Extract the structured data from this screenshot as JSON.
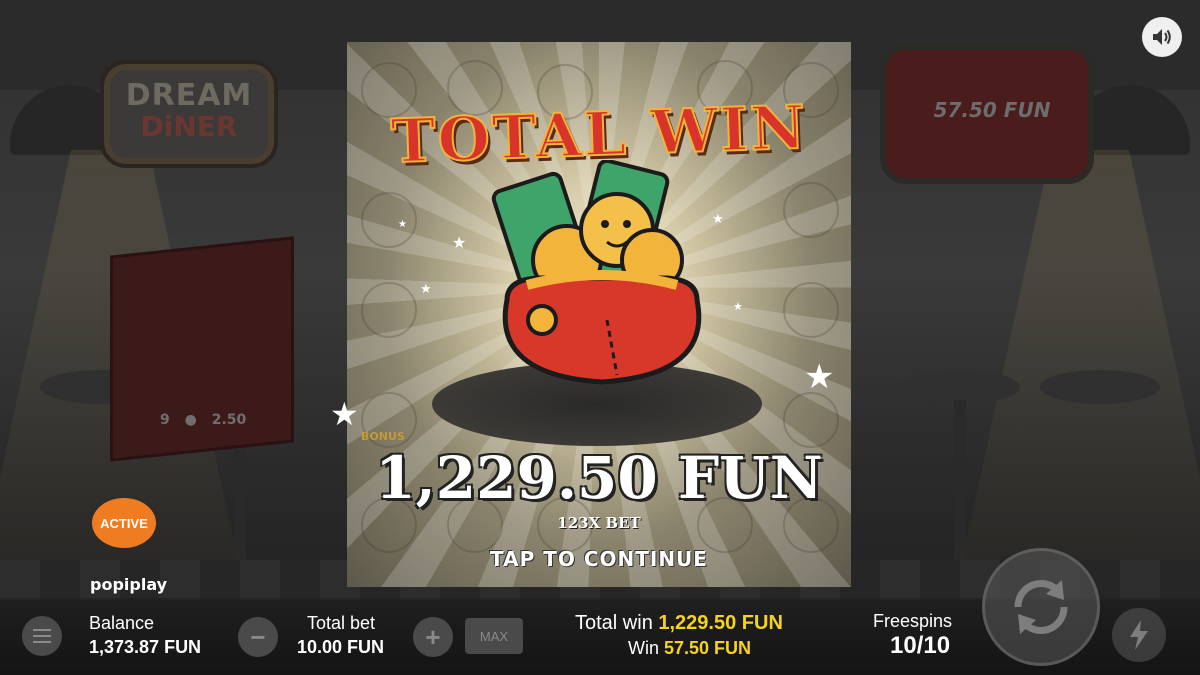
{
  "game": {
    "logo_line1": "DREAM",
    "logo_line2": "DiNER",
    "brand": "popiplay",
    "active_badge": "ACTIVE"
  },
  "background": {
    "info_card_values": [
      "9",
      "2.50"
    ],
    "win_box_amount": "57.50 FUN"
  },
  "modal": {
    "title": "TOTAL WIN",
    "amount": "1,229.50 FUN",
    "multiplier": "123X BET",
    "tap_to_continue": "TAP TO CONTINUE",
    "bonus_symbol_label": "BONUS"
  },
  "bottom_bar": {
    "balance_label": "Balance",
    "balance_value": "1,373.87 FUN",
    "total_bet_label": "Total bet",
    "total_bet_value": "10.00 FUN",
    "minus": "−",
    "plus": "+",
    "max_label": "MAX",
    "total_win_label": "Total win",
    "total_win_value": "1,229.50 FUN",
    "win_label": "Win",
    "win_value": "57.50 FUN",
    "freespins_label": "Freespins",
    "freespins_value": "10/10"
  },
  "colors": {
    "title_red": "#d8342a",
    "highlight_yellow": "#f6d31f",
    "active_orange": "#f07c22"
  },
  "icons": {
    "menu": "menu-icon",
    "sound": "speaker-icon",
    "spin": "spin-arrows-icon",
    "turbo": "lightning-icon",
    "purse": "coin-purse-icon"
  }
}
